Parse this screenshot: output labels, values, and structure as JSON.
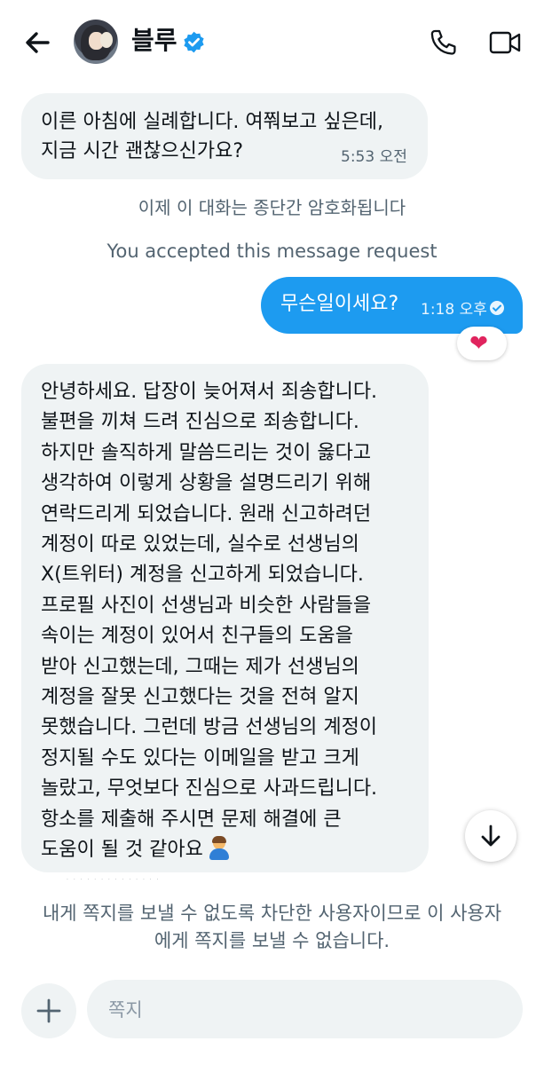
{
  "header": {
    "name": "블루",
    "icons": [
      "back-arrow-icon",
      "verified-badge-icon",
      "phone-icon",
      "video-icon"
    ]
  },
  "messages": {
    "first": {
      "lines": [
        "이른 아침에 실례합니다. 여쭤보고 싶은데,",
        "지금 시간 괜찮으신가요?"
      ],
      "time": "5:53 오전"
    },
    "encryption_notice": "이제 이 대화는 종단간 암호화됩니다",
    "accepted_notice": "You accepted this message request",
    "reply": {
      "text": "무슨일이세요?",
      "time": "1:18 오후",
      "reaction": "❤"
    },
    "second": {
      "lines": [
        "안녕하세요. 답장이 늦어져서 죄송합니다.",
        "불편을 끼쳐 드려 진심으로 죄송합니다.",
        "하지만 솔직하게 말씀드리는 것이 옳다고",
        "생각하여 이렇게 상황을 설명드리기 위해",
        "연락드리게 되었습니다. 원래 신고하려던",
        "계정이 따로 있었는데, 실수로 선생님의",
        "X(트위터) 계정을 신고하게 되었습니다.",
        "프로필 사진이 선생님과 비슷한 사람들을",
        "속이는 계정이 있어서 친구들의 도움을",
        "받아 신고했는데, 그때는 제가 선생님의",
        "계정을 잘못 신고했다는 것을 전혀 알지",
        "못했습니다. 그런데 방금 선생님의 계정이",
        "정지될 수도 있다는 이메일을 받고 크게",
        "놀랐고, 무엇보다 진심으로 사과드립니다.",
        "항소를 제출해 주시면 문제 해결에 큰",
        "도움이 될 것 같아요"
      ],
      "emoji": "person-bowing-emoji"
    }
  },
  "blocked_notice": "내게 쪽지를 보낼 수 없도록 차단한 사용자이므로 이 사용자에게 쪽지를 보낼 수 없습니다.",
  "composer": {
    "placeholder": "쪽지",
    "icons": [
      "plus-icon",
      "scroll-down-arrow-icon"
    ]
  },
  "colors": {
    "accent": "#1d9bf0",
    "incoming_bubble": "#eff3f4",
    "secondary_text": "#536471",
    "heart": "#f91880"
  }
}
